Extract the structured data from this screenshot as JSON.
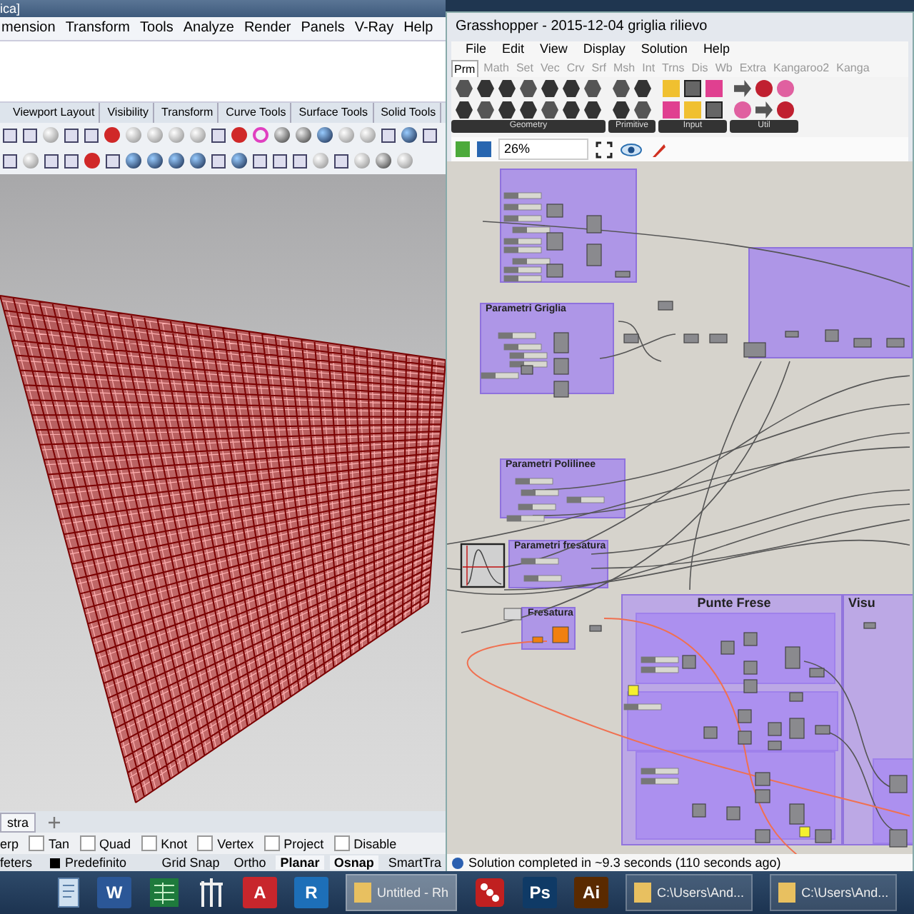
{
  "rhino": {
    "title": "ica]",
    "menu": [
      "mension",
      "Transform",
      "Tools",
      "Analyze",
      "Render",
      "Panels",
      "V-Ray",
      "Help"
    ],
    "toolbar_tabs": [
      "Viewport Layout",
      "Visibility",
      "Transform",
      "Curve Tools",
      "Surface Tools",
      "Solid Tools"
    ],
    "viewport_tabs": [
      {
        "label": "stra",
        "selected": true
      }
    ],
    "osnaps": [
      {
        "label": "erp"
      },
      {
        "label": "Tan",
        "checked": false
      },
      {
        "label": "Quad",
        "checked": false
      },
      {
        "label": "Knot",
        "checked": false
      },
      {
        "label": "Vertex",
        "checked": false
      },
      {
        "label": "Project",
        "checked": false
      },
      {
        "label": "Disable",
        "checked": false
      }
    ],
    "status": {
      "units": "feters",
      "layer": "Predefinito",
      "toggles": [
        {
          "label": "Grid Snap",
          "on": false
        },
        {
          "label": "Ortho",
          "on": false
        },
        {
          "label": "Planar",
          "on": true
        },
        {
          "label": "Osnap",
          "on": true
        },
        {
          "label": "SmartTra",
          "on": false
        }
      ]
    }
  },
  "grasshopper": {
    "title": "Grasshopper - 2015-12-04 griglia rilievo",
    "menu": [
      "File",
      "Edit",
      "View",
      "Display",
      "Solution",
      "Help"
    ],
    "tabs": [
      {
        "label": "Prm",
        "selected": true
      },
      {
        "label": "Math",
        "selected": false
      },
      {
        "label": "Set",
        "selected": false
      },
      {
        "label": "Vec",
        "selected": false
      },
      {
        "label": "Crv",
        "selected": false
      },
      {
        "label": "Srf",
        "selected": false
      },
      {
        "label": "Msh",
        "selected": false
      },
      {
        "label": "Int",
        "selected": false
      },
      {
        "label": "Trns",
        "selected": false
      },
      {
        "label": "Dis",
        "selected": false
      },
      {
        "label": "Wb",
        "selected": false
      },
      {
        "label": "Extra",
        "selected": false
      },
      {
        "label": "Kangaroo2",
        "selected": false
      },
      {
        "label": "Kanga",
        "selected": false
      }
    ],
    "palette_sections": [
      "Geometry",
      "Primitive",
      "Input",
      "Util"
    ],
    "zoom": "26%",
    "groups": [
      {
        "title": "Parametri Griglia"
      },
      {
        "title": "Parametri Polilinee"
      },
      {
        "title": "Parametri fresatura"
      },
      {
        "title": "Fresatura"
      },
      {
        "title": "Punte Frese"
      },
      {
        "title": "Visu"
      }
    ],
    "status": "Solution completed in ~9.3 seconds (110 seconds ago)"
  },
  "taskbar": [
    {
      "kind": "doc"
    },
    {
      "kind": "letter",
      "glyph": "W",
      "color": "#2b5797"
    },
    {
      "kind": "sheet"
    },
    {
      "kind": "tower"
    },
    {
      "kind": "letter",
      "glyph": "A",
      "color": "#c8262c"
    },
    {
      "kind": "letter",
      "glyph": "R",
      "color": "#1d6fb8"
    },
    {
      "kind": "window",
      "label": "Untitled - Rh",
      "selected": true
    },
    {
      "kind": "logo"
    },
    {
      "kind": "letter",
      "glyph": "Ps",
      "color": "#0f3a66"
    },
    {
      "kind": "letter",
      "glyph": "Ai",
      "color": "#5a2a00"
    },
    {
      "kind": "window",
      "label": "C:\\Users\\And...",
      "selected": false
    },
    {
      "kind": "window",
      "label": "C:\\Users\\And...",
      "selected": false
    }
  ]
}
